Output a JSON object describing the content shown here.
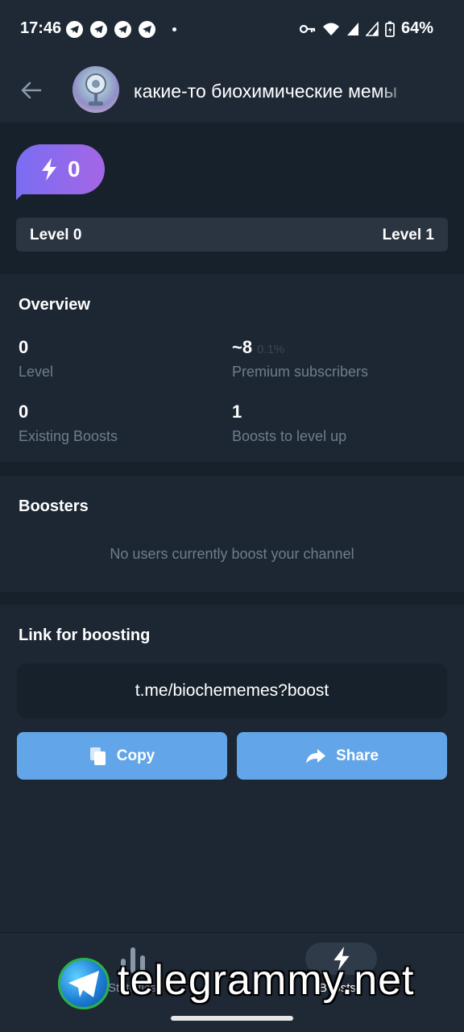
{
  "status_bar": {
    "time": "17:46",
    "battery": "64%",
    "notification_icons": [
      "telegram-icon",
      "telegram-icon",
      "telegram-icon",
      "telegram-icon"
    ]
  },
  "header": {
    "title": "какие-то биохимические мемы"
  },
  "boost_badge": {
    "count": "0"
  },
  "level_bar": {
    "current": "Level 0",
    "next": "Level 1",
    "progress": 0
  },
  "overview": {
    "title": "Overview",
    "stats": [
      {
        "value": "0",
        "label": "Level"
      },
      {
        "value": "~8",
        "extra": "0.1%",
        "label": "Premium subscribers"
      },
      {
        "value": "0",
        "label": "Existing Boosts"
      },
      {
        "value": "1",
        "label": "Boosts to level up"
      }
    ]
  },
  "boosters": {
    "title": "Boosters",
    "empty_text": "No users currently boost your channel"
  },
  "link": {
    "title": "Link for boosting",
    "url": "t.me/biochememes?boost",
    "copy_label": "Copy",
    "share_label": "Share"
  },
  "tabs": {
    "statistics_label": "Statistics",
    "boosts_label": "Boosts"
  },
  "watermark": {
    "text": "telegrammy.net"
  },
  "colors": {
    "background": "#1d2733",
    "section_dark": "#17212b",
    "accent_purple": "#7a6df2",
    "button_blue": "#62a5e8",
    "muted_text": "#6f7d8c"
  }
}
